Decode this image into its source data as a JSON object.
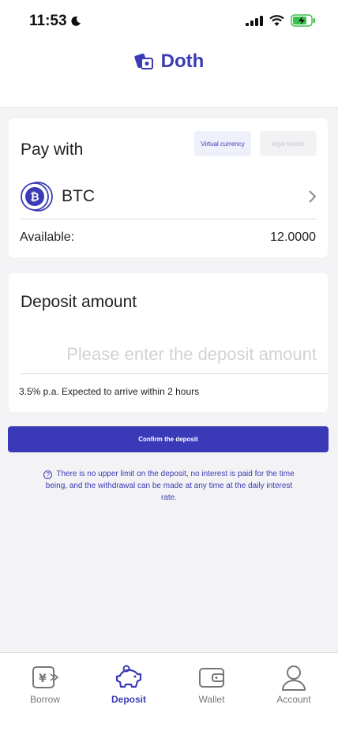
{
  "status_bar": {
    "time": "11:53"
  },
  "header": {
    "brand": "Doth"
  },
  "pay_card": {
    "title": "Pay with",
    "tab_virtual": "Virtual currency",
    "tab_legal": "legal tender",
    "coin": "BTC",
    "available_label": "Available:",
    "available_value": "12.0000"
  },
  "deposit_card": {
    "title": "Deposit amount",
    "placeholder": "Please enter the deposit amount",
    "rate_text": "3.5% p.a. Expected to arrive within 2 hours"
  },
  "confirm_label": "Confirm the deposit",
  "notice": "There is no upper limit on the deposit, no interest is paid for the time being, and the withdrawal can be made at any time at the daily interest rate.",
  "tabbar": {
    "active": "Deposit",
    "items": [
      {
        "label": "Borrow",
        "icon": "borrow-icon"
      },
      {
        "label": "Deposit",
        "icon": "piggy-bank-icon"
      },
      {
        "label": "Wallet",
        "icon": "wallet-icon"
      },
      {
        "label": "Account",
        "icon": "user-icon"
      }
    ]
  },
  "colors": {
    "accent": "#3b3bb5",
    "background": "#f3f3f5",
    "button": "#3a3ab8",
    "battery": "#38c24a"
  }
}
